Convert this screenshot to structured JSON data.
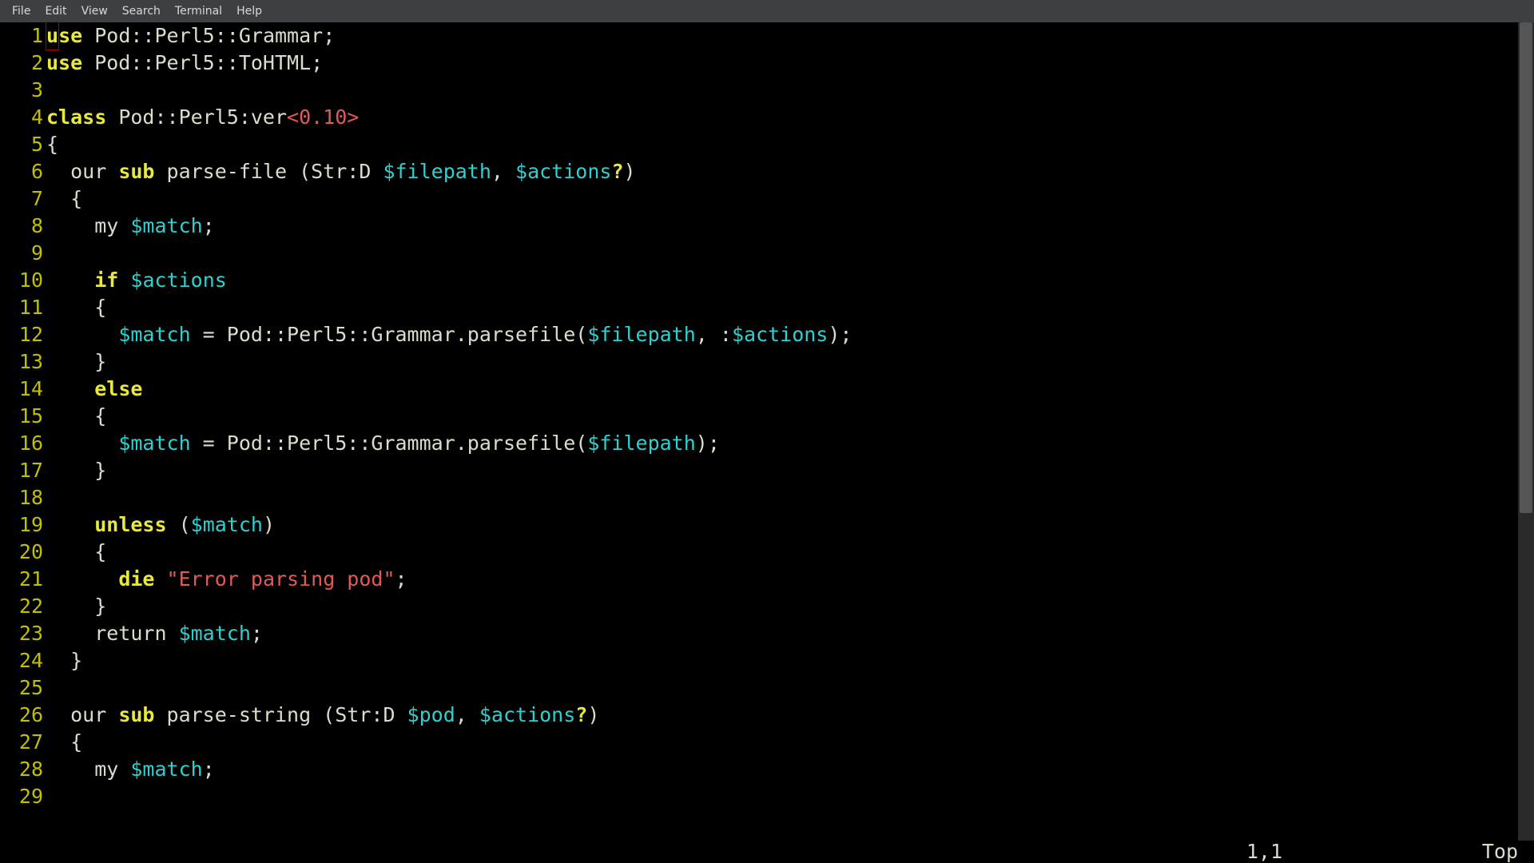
{
  "menubar": {
    "items": [
      "File",
      "Edit",
      "View",
      "Search",
      "Terminal",
      "Help"
    ]
  },
  "statusbar": {
    "position": "1,1",
    "scroll": "Top"
  },
  "cursor": {
    "line": 1,
    "col": 1
  },
  "code_lines": [
    {
      "n": 1,
      "tokens": [
        {
          "t": "use",
          "c": "kw",
          "cursor": true
        },
        {
          "t": " Pod::Perl5::Grammar;",
          "c": "plain"
        }
      ]
    },
    {
      "n": 2,
      "tokens": [
        {
          "t": "use",
          "c": "kw"
        },
        {
          "t": " Pod::Perl5::ToHTML;",
          "c": "plain"
        }
      ]
    },
    {
      "n": 3,
      "tokens": [
        {
          "t": "",
          "c": "plain"
        }
      ]
    },
    {
      "n": 4,
      "tokens": [
        {
          "t": "class",
          "c": "kw"
        },
        {
          "t": " Pod::Perl5:ver",
          "c": "plain"
        },
        {
          "t": "<0.10>",
          "c": "num"
        }
      ]
    },
    {
      "n": 5,
      "tokens": [
        {
          "t": "{",
          "c": "plain"
        }
      ]
    },
    {
      "n": 6,
      "tokens": [
        {
          "t": "  our ",
          "c": "plain"
        },
        {
          "t": "sub",
          "c": "kw"
        },
        {
          "t": " parse-file (Str:D ",
          "c": "plain"
        },
        {
          "t": "$filepath",
          "c": "var"
        },
        {
          "t": ", ",
          "c": "plain"
        },
        {
          "t": "$actions",
          "c": "var"
        },
        {
          "t": "?",
          "c": "kw"
        },
        {
          "t": ")",
          "c": "plain"
        }
      ]
    },
    {
      "n": 7,
      "tokens": [
        {
          "t": "  {",
          "c": "plain"
        }
      ]
    },
    {
      "n": 8,
      "tokens": [
        {
          "t": "    my ",
          "c": "plain"
        },
        {
          "t": "$match",
          "c": "var"
        },
        {
          "t": ";",
          "c": "plain"
        }
      ]
    },
    {
      "n": 9,
      "tokens": [
        {
          "t": "",
          "c": "plain"
        }
      ]
    },
    {
      "n": 10,
      "tokens": [
        {
          "t": "    ",
          "c": "plain"
        },
        {
          "t": "if",
          "c": "kw"
        },
        {
          "t": " ",
          "c": "plain"
        },
        {
          "t": "$actions",
          "c": "var"
        }
      ]
    },
    {
      "n": 11,
      "tokens": [
        {
          "t": "    {",
          "c": "plain"
        }
      ]
    },
    {
      "n": 12,
      "tokens": [
        {
          "t": "      ",
          "c": "plain"
        },
        {
          "t": "$match",
          "c": "var"
        },
        {
          "t": " = Pod::Perl5::Grammar.parsefile(",
          "c": "plain"
        },
        {
          "t": "$filepath",
          "c": "var"
        },
        {
          "t": ", :",
          "c": "plain"
        },
        {
          "t": "$actions",
          "c": "var"
        },
        {
          "t": ");",
          "c": "plain"
        }
      ]
    },
    {
      "n": 13,
      "tokens": [
        {
          "t": "    }",
          "c": "plain"
        }
      ]
    },
    {
      "n": 14,
      "tokens": [
        {
          "t": "    ",
          "c": "plain"
        },
        {
          "t": "else",
          "c": "kw"
        }
      ]
    },
    {
      "n": 15,
      "tokens": [
        {
          "t": "    {",
          "c": "plain"
        }
      ]
    },
    {
      "n": 16,
      "tokens": [
        {
          "t": "      ",
          "c": "plain"
        },
        {
          "t": "$match",
          "c": "var"
        },
        {
          "t": " = Pod::Perl5::Grammar.parsefile(",
          "c": "plain"
        },
        {
          "t": "$filepath",
          "c": "var"
        },
        {
          "t": ");",
          "c": "plain"
        }
      ]
    },
    {
      "n": 17,
      "tokens": [
        {
          "t": "    }",
          "c": "plain"
        }
      ]
    },
    {
      "n": 18,
      "tokens": [
        {
          "t": "",
          "c": "plain"
        }
      ]
    },
    {
      "n": 19,
      "tokens": [
        {
          "t": "    ",
          "c": "plain"
        },
        {
          "t": "unless",
          "c": "kw"
        },
        {
          "t": " (",
          "c": "plain"
        },
        {
          "t": "$match",
          "c": "var"
        },
        {
          "t": ")",
          "c": "plain"
        }
      ]
    },
    {
      "n": 20,
      "tokens": [
        {
          "t": "    {",
          "c": "plain"
        }
      ]
    },
    {
      "n": 21,
      "tokens": [
        {
          "t": "      ",
          "c": "plain"
        },
        {
          "t": "die",
          "c": "kw"
        },
        {
          "t": " ",
          "c": "plain"
        },
        {
          "t": "\"Error parsing pod\"",
          "c": "str"
        },
        {
          "t": ";",
          "c": "plain"
        }
      ]
    },
    {
      "n": 22,
      "tokens": [
        {
          "t": "    }",
          "c": "plain"
        }
      ]
    },
    {
      "n": 23,
      "tokens": [
        {
          "t": "    return ",
          "c": "plain"
        },
        {
          "t": "$match",
          "c": "var"
        },
        {
          "t": ";",
          "c": "plain"
        }
      ]
    },
    {
      "n": 24,
      "tokens": [
        {
          "t": "  }",
          "c": "plain"
        }
      ]
    },
    {
      "n": 25,
      "tokens": [
        {
          "t": "",
          "c": "plain"
        }
      ]
    },
    {
      "n": 26,
      "tokens": [
        {
          "t": "  our ",
          "c": "plain"
        },
        {
          "t": "sub",
          "c": "kw"
        },
        {
          "t": " parse-string (Str:D ",
          "c": "plain"
        },
        {
          "t": "$pod",
          "c": "var"
        },
        {
          "t": ", ",
          "c": "plain"
        },
        {
          "t": "$actions",
          "c": "var"
        },
        {
          "t": "?",
          "c": "kw"
        },
        {
          "t": ")",
          "c": "plain"
        }
      ]
    },
    {
      "n": 27,
      "tokens": [
        {
          "t": "  {",
          "c": "plain"
        }
      ]
    },
    {
      "n": 28,
      "tokens": [
        {
          "t": "    my ",
          "c": "plain"
        },
        {
          "t": "$match",
          "c": "var"
        },
        {
          "t": ";",
          "c": "plain"
        }
      ]
    },
    {
      "n": 29,
      "tokens": [
        {
          "t": "",
          "c": "plain"
        }
      ]
    }
  ]
}
